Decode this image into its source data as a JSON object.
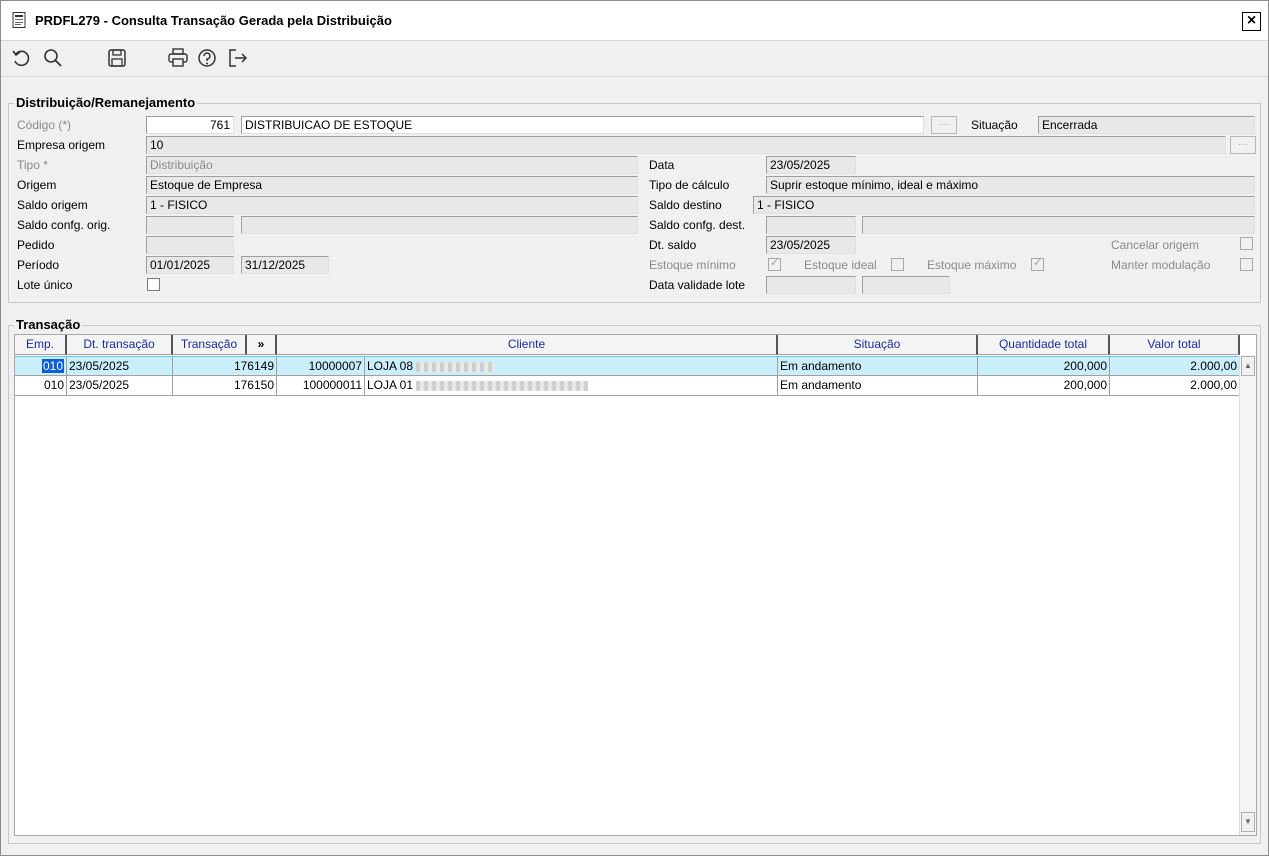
{
  "window": {
    "title": "PRDFL279 - Consulta Transação Gerada pela Distribuição",
    "close_label": "×"
  },
  "toolbar": {
    "icons": [
      "undo-icon",
      "search-icon",
      "save-icon",
      "print-icon",
      "help-icon",
      "exit-icon"
    ]
  },
  "distribuicao": {
    "group_title": "Distribuição/Remanejamento",
    "codigo_label": "Código (*)",
    "codigo_value": "761",
    "codigo_desc": "DISTRIBUICAO DE ESTOQUE",
    "situacao_label": "Situação",
    "situacao_value": "Encerrada",
    "empresa_origem_label": "Empresa origem",
    "empresa_origem_value": "10",
    "tipo_label": "Tipo *",
    "tipo_value": "Distribuição",
    "origem_label": "Origem",
    "origem_value": "Estoque de Empresa",
    "saldo_origem_label": "Saldo origem",
    "saldo_origem_value": "1 - FISICO",
    "saldo_config_orig_label": "Saldo confg. orig.",
    "saldo_config_orig_value": "",
    "saldo_config_orig_desc": "",
    "pedido_label": "Pedido",
    "pedido_value": "",
    "periodo_label": "Período",
    "periodo_inicio": "01/01/2025",
    "periodo_fim": "31/12/2025",
    "lote_unico_label": "Lote único",
    "data_label": "Data",
    "data_value": "23/05/2025",
    "tipo_calculo_label": "Tipo de cálculo",
    "tipo_calculo_value": "Suprir estoque mínimo, ideal e máximo",
    "saldo_destino_label": "Saldo destino",
    "saldo_destino_value": "1 - FISICO",
    "saldo_config_dest_label": "Saldo confg. dest.",
    "saldo_config_dest_value": "",
    "saldo_config_dest_desc": "",
    "dt_saldo_label": "Dt. saldo",
    "dt_saldo_value": "23/05/2025",
    "estoque_minimo_label": "Estoque mínimo",
    "estoque_ideal_label": "Estoque ideal",
    "estoque_maximo_label": "Estoque máximo",
    "cancelar_origem_label": "Cancelar origem",
    "manter_modulacao_label": "Manter modulação",
    "data_validade_lote_label": "Data validade lote",
    "lookup_label": "···"
  },
  "transacao": {
    "group_title": "Transação",
    "columns": {
      "emp": "Emp.",
      "dt_transacao": "Dt. transação",
      "transacao": "Transação",
      "more": "»",
      "cliente": "Cliente",
      "situacao": "Situação",
      "quantidade_total": "Quantidade total",
      "valor_total": "Valor total"
    },
    "rows": [
      {
        "emp": "010",
        "dt": "23/05/2025",
        "transacao": "176149",
        "cliente_cod": "10000007",
        "cliente_nome": "LOJA 08",
        "situacao": "Em andamento",
        "quantidade": "200,000",
        "valor": "2.000,00"
      },
      {
        "emp": "010",
        "dt": "23/05/2025",
        "transacao": "176150",
        "cliente_cod": "100000011",
        "cliente_nome": "LOJA 01",
        "situacao": "Em andamento",
        "quantidade": "200,000",
        "valor": "2.000,00"
      }
    ],
    "scroll_up": "▲",
    "scroll_down": "▼"
  }
}
